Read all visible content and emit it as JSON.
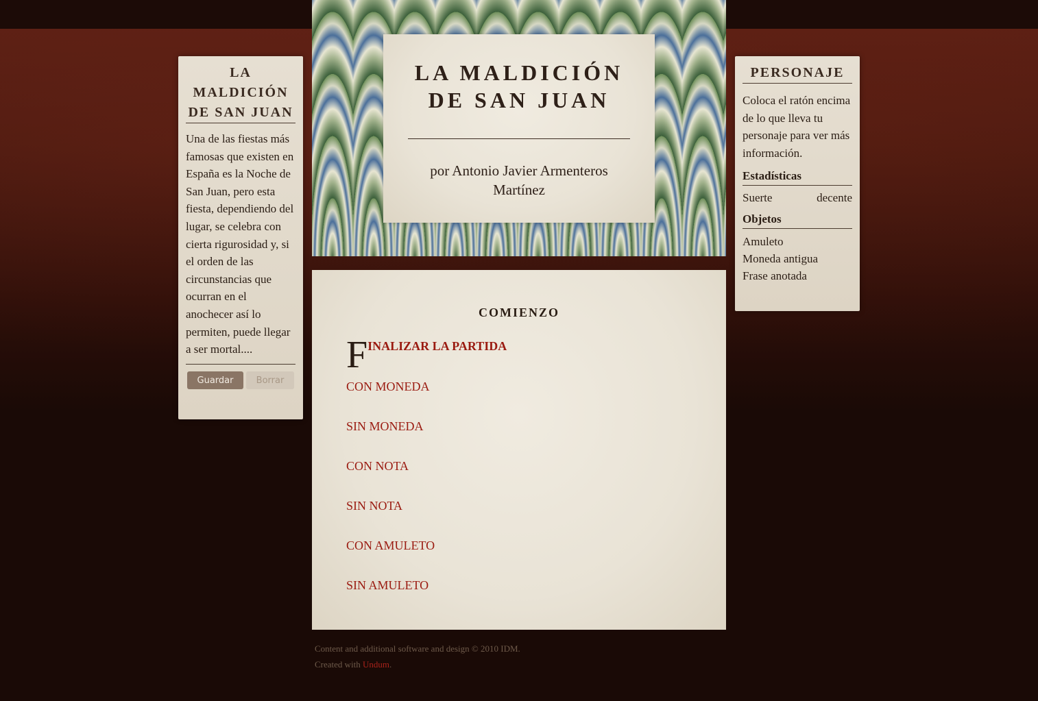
{
  "game": {
    "title": "La Maldición de San Juan",
    "byline": "por Antonio Javier Armenteros Martínez"
  },
  "left_panel": {
    "title": "La Maldición de San Juan",
    "description": "Una de las fiestas más famosas que existen en España es la Noche de San Juan, pero esta fiesta, dependiendo del lugar, se celebra con cierta rigurosidad y, si el orden de las circunstancias que ocurran en el anochecer así lo permiten, puede llegar a ser mortal....",
    "save_label": "Guardar",
    "delete_label": "Borrar"
  },
  "right_panel": {
    "title": "Personaje",
    "help": "Coloca el ratón encima de lo que lleva tu personaje para ver más información.",
    "stats_heading": "Estadísticas",
    "stat_name": "Suerte",
    "stat_value": "decente",
    "items_heading": "Objetos",
    "items": [
      "Amuleto",
      "Moneda antigua",
      "Frase anotada"
    ]
  },
  "content": {
    "heading": "Comienzo",
    "dropcap": "F",
    "first_choice_rest": "inalizar la partida",
    "choices": [
      "con moneda",
      "sin moneda",
      "con nota",
      "sin nota",
      "con amuleto",
      "sin amuleto"
    ]
  },
  "footer": {
    "line1": "Content and additional software and design © 2010 IDM.",
    "line2_prefix": "Created with ",
    "link": "Undum",
    "line2_suffix": "."
  },
  "colors": {
    "link": "#9a1a10",
    "background": "#1a0a06",
    "paper": "#e9e3d6"
  }
}
